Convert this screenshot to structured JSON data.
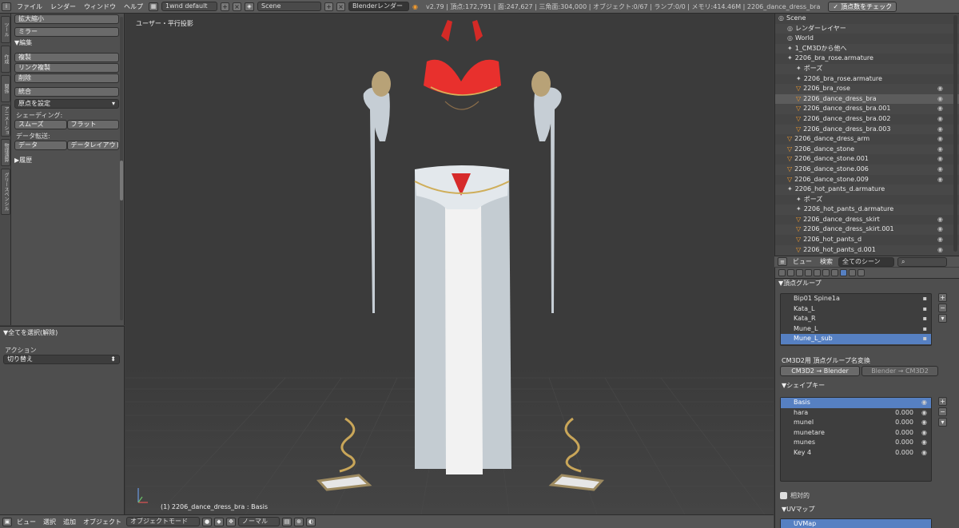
{
  "topbar": {
    "menus": [
      "ファイル",
      "レンダー",
      "ウィンドウ",
      "ヘルプ"
    ],
    "screen_layout": "1wnd default",
    "scene": "Scene",
    "render_engine": "Blenderレンダー",
    "stats": "v2.79 | 頂点:172,791 | 面:247,627 | 三角面:304,000 | オブジェクト:0/67 | ランプ:0/0 | メモリ:414.46M | 2206_dance_dress_bra",
    "check_button": "頂点数をチェック"
  },
  "tabs": [
    "ツール",
    "作成",
    "関係",
    "アニメーション",
    "物理演算",
    "グリースペンシル"
  ],
  "tool_shelf": {
    "top_buttons": [
      "拡大縮小",
      "ミラー"
    ],
    "edit_header": "▼編集",
    "edit_buttons": [
      "複製",
      "リンク複製",
      "削除"
    ],
    "join_button": "統合",
    "origin_dropdown": "原点を設定",
    "shading_label": "シェーディング:",
    "shading_smooth": "スムーズ",
    "shading_flat": "フラット",
    "data_transfer_label": "データ転送:",
    "data_button": "データ",
    "data_layout_button": "データレイアウト",
    "history_header": "▶履歴"
  },
  "operator_panel": {
    "header": "▼全てを選択(解除)",
    "action_label": "アクション",
    "action_value": "切り替え"
  },
  "viewport": {
    "view_label": "ユーザー・平行投影",
    "active_object": "(1) 2206_dance_dress_bra : Basis"
  },
  "bottombar": {
    "menus": [
      "ビュー",
      "選択",
      "追加",
      "オブジェクト"
    ],
    "mode": "オブジェクトモード",
    "transform": "ノーマル"
  },
  "outliner": {
    "rows": [
      {
        "label": "Scene",
        "indent": 0,
        "icon": "scene"
      },
      {
        "label": "レンダーレイヤー",
        "indent": 1,
        "icon": "render"
      },
      {
        "label": "World",
        "indent": 1,
        "icon": "world"
      },
      {
        "label": "1_CM3Dから他へ",
        "indent": 1,
        "icon": "armature"
      },
      {
        "label": "2206_bra_rose.armature",
        "indent": 1,
        "icon": "armature"
      },
      {
        "label": "ポーズ",
        "indent": 2,
        "icon": "pose"
      },
      {
        "label": "2206_bra_rose.armature",
        "indent": 2,
        "icon": "armature"
      },
      {
        "label": "2206_bra_rose",
        "indent": 2,
        "icon": "mesh"
      },
      {
        "label": "2206_dance_dress_bra",
        "indent": 2,
        "icon": "mesh",
        "selected": true
      },
      {
        "label": "2206_dance_dress_bra.001",
        "indent": 2,
        "icon": "mesh"
      },
      {
        "label": "2206_dance_dress_bra.002",
        "indent": 2,
        "icon": "mesh"
      },
      {
        "label": "2206_dance_dress_bra.003",
        "indent": 2,
        "icon": "mesh"
      },
      {
        "label": "2206_dance_dress_arm",
        "indent": 1,
        "icon": "mesh"
      },
      {
        "label": "2206_dance_stone",
        "indent": 1,
        "icon": "mesh"
      },
      {
        "label": "2206_dance_stone.001",
        "indent": 1,
        "icon": "mesh"
      },
      {
        "label": "2206_dance_stone.006",
        "indent": 1,
        "icon": "mesh"
      },
      {
        "label": "2206_dance_stone.009",
        "indent": 1,
        "icon": "mesh"
      },
      {
        "label": "2206_hot_pants_d.armature",
        "indent": 1,
        "icon": "armature"
      },
      {
        "label": "ポーズ",
        "indent": 2,
        "icon": "pose"
      },
      {
        "label": "2206_hot_pants_d.armature",
        "indent": 2,
        "icon": "armature"
      },
      {
        "label": "2206_dance_dress_skirt",
        "indent": 2,
        "icon": "mesh"
      },
      {
        "label": "2206_dance_dress_skirt.001",
        "indent": 2,
        "icon": "mesh"
      },
      {
        "label": "2206_hot_pants_d",
        "indent": 2,
        "icon": "mesh"
      },
      {
        "label": "2206_hot_pants_d.001",
        "indent": 2,
        "icon": "mesh"
      }
    ],
    "bar_view": "ビュー",
    "bar_search": "検索",
    "bar_filter": "全てのシーン"
  },
  "properties": {
    "vgroup_header": "▼頂点グループ",
    "vgroups": [
      "Bip01 Spine1a",
      "Kata_L",
      "Kata_R",
      "Mune_L",
      "Mune_L_sub"
    ],
    "vgroup_selected": 4,
    "cm3d2_label": "CM3D2用 頂点グループ名変換",
    "cm3d2_to_blender": "CM3D2 → Blender",
    "blender_to_cm3d2": "Blender → CM3D2",
    "shapekey_header": "▼シェイプキー",
    "shapekeys": [
      {
        "name": "Basis",
        "value": ""
      },
      {
        "name": "hara",
        "value": "0.000"
      },
      {
        "name": "munel",
        "value": "0.000"
      },
      {
        "name": "munetare",
        "value": "0.000"
      },
      {
        "name": "munes",
        "value": "0.000"
      },
      {
        "name": "Key 4",
        "value": "0.000"
      }
    ],
    "relative_label": "相対的",
    "uvmap_header": "▼UVマップ",
    "uvmap_item": "UVMap"
  }
}
